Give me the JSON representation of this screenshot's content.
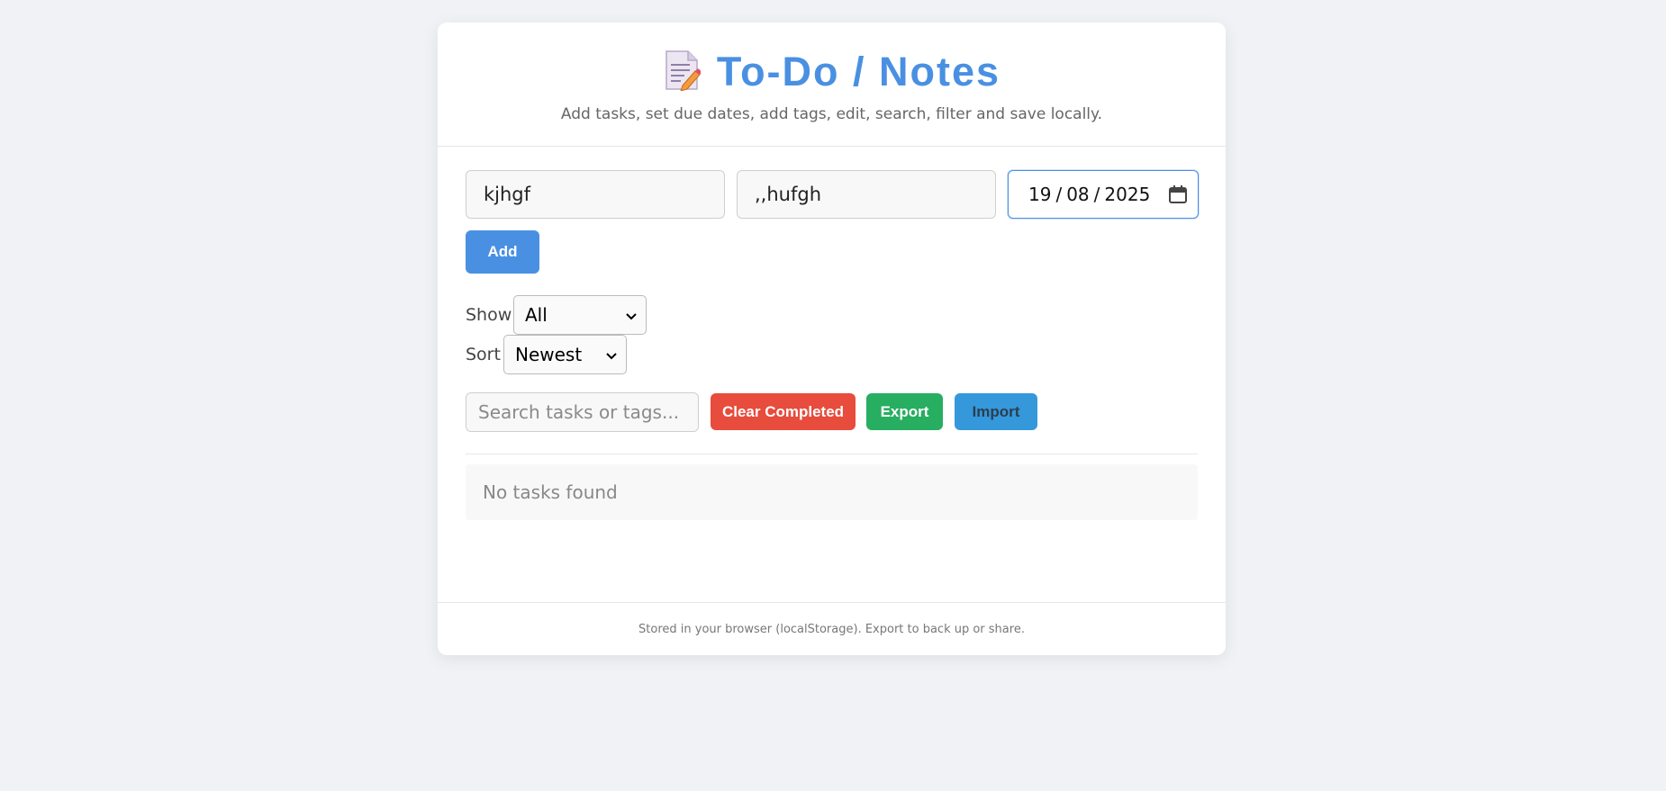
{
  "header": {
    "icon": "memo-icon",
    "title": "To-Do / Notes",
    "subtitle": "Add tasks, set due dates, add tags, edit, search, filter and save locally."
  },
  "form": {
    "task_value": "kjhgf",
    "tags_value": ",,hufgh",
    "date": {
      "day": "19",
      "month": "08",
      "year": "2025"
    },
    "add_label": "Add"
  },
  "filters": {
    "show_label": "Show",
    "show_value": "All",
    "sort_label": "Sort",
    "sort_value": "Newest"
  },
  "toolbar": {
    "search_placeholder": "Search tasks or tags...",
    "clear_label": "Clear Completed",
    "export_label": "Export",
    "import_label": "Import"
  },
  "list": {
    "empty_text": "No tasks found"
  },
  "footer": {
    "text": "Stored in your browser (localStorage). Export to back up or share."
  },
  "colors": {
    "accent": "#4a90e2",
    "clear": "#e74c3c",
    "export": "#27ae60",
    "import": "#3498db",
    "background": "#f0f2f6"
  }
}
